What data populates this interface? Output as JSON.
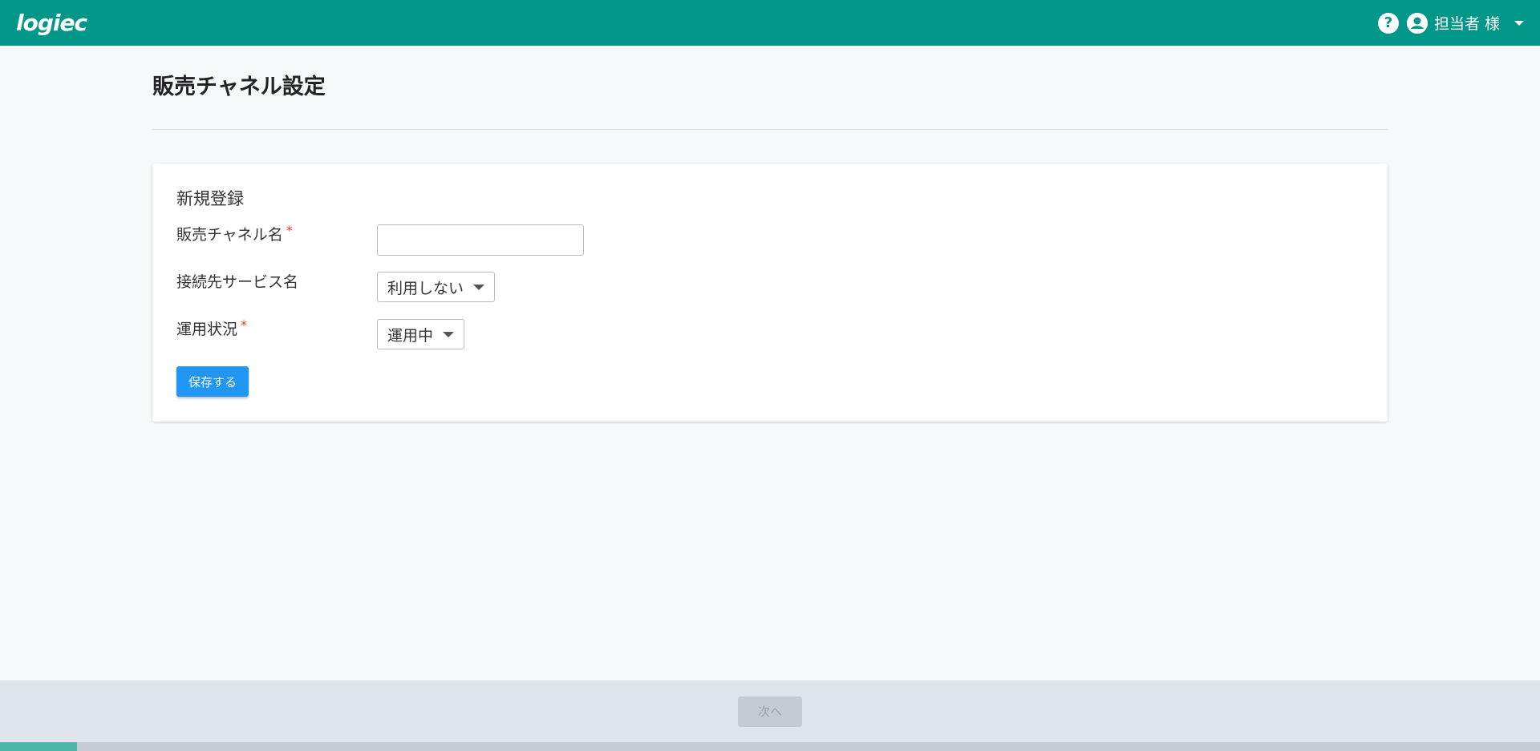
{
  "header": {
    "logo": "logiec",
    "help_icon": "help-circle-icon",
    "user_icon": "account-circle-icon",
    "user_label": "担当者 様"
  },
  "page": {
    "title": "販売チャネル設定"
  },
  "form": {
    "section_title": "新規登録",
    "channel_name_label": "販売チャネル名",
    "channel_name_value": "",
    "service_label": "接続先サービス名",
    "service_selected": "利用しない",
    "status_label": "運用状況",
    "status_selected": "運用中",
    "required_mark": "*",
    "save_label": "保存する"
  },
  "footer": {
    "next_label": "次へ",
    "progress": 0.05
  },
  "colors": {
    "header_bg": "#009688",
    "primary_button": "#2196f3",
    "required": "#e53935",
    "progress_fill": "#4db6ac"
  }
}
